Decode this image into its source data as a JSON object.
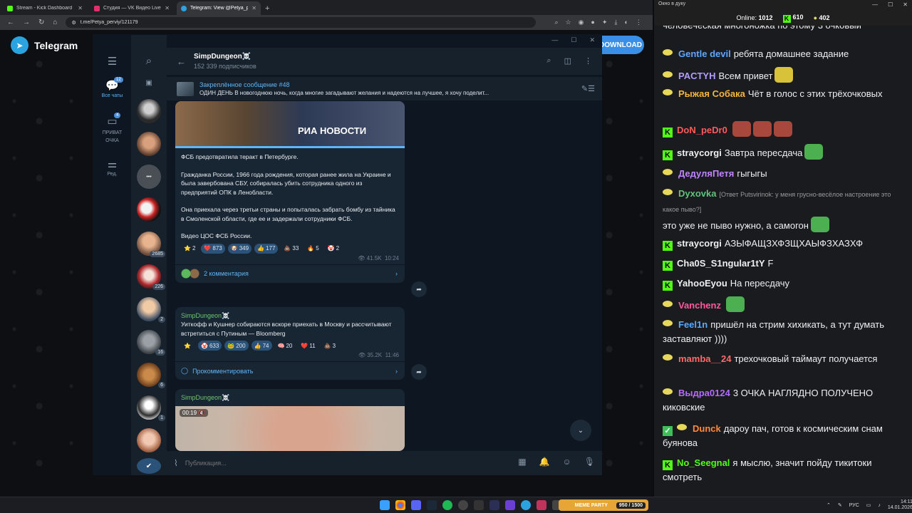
{
  "browser": {
    "tabs": [
      {
        "label": "Stream - Kick Dashboard",
        "color": "#53fc18"
      },
      {
        "label": "Студия — VK Видео Live",
        "color": "#e0306b"
      },
      {
        "label": "Telegram: View @Petya_perviy",
        "color": "#2aa3e0"
      }
    ],
    "new_tab": "+",
    "url": "t.me/Petya_perviy/121179"
  },
  "telegram_web": {
    "logo_text": "Telegram",
    "download_label": "DOWNLOAD"
  },
  "tg": {
    "rail": {
      "all_chats": "Все чаты",
      "all_chats_badge": "12",
      "private": "ПРИВАТ ОЧКА",
      "private_badge": "4",
      "edit": "Ред."
    },
    "avatar_badges": [
      "2685",
      "226",
      "2",
      "16",
      "6",
      "1"
    ],
    "channel": {
      "title": "SimpDungeon☠️",
      "subscribers": "152 339 подписчиков"
    },
    "pinned": {
      "title": "Закреплённое сообщение #48",
      "text": "ОДИН ДЕНЬ  В новогоднюю ночь, когда многие загадывают желания и надеются на лучшее, я хочу поделит..."
    },
    "post1": {
      "image_watermark": "РИА НОВОСТИ",
      "p1": "ФСБ предотвратила теракт в Петербурге.",
      "p2": "Гражданка России, 1966 года рождения, которая ранее жила на Украине и была завербована СБУ, собиралась убить сотрудника одного из предприятий ОПК в Ленобласти.",
      "p3": "Она приехала через третьи страны и попыталась забрать бомбу из тайника в Смоленской области, где ее и задержали сотрудники ФСБ.",
      "p4": "Видео ЦОС ФСБ России.",
      "reactions": [
        {
          "e": "⭐",
          "n": "2",
          "plain": true
        },
        {
          "e": "❤️",
          "n": "873"
        },
        {
          "e": "🐶",
          "n": "349"
        },
        {
          "e": "👍",
          "n": "177"
        },
        {
          "e": "💩",
          "n": "33",
          "plain": true
        },
        {
          "e": "🔥",
          "n": "5",
          "plain": true
        },
        {
          "e": "🤡",
          "n": "2",
          "plain": true
        }
      ],
      "views": "41.5K",
      "time": "10:24",
      "comments": "2 комментария"
    },
    "post2": {
      "sender": "SimpDungeon☠️",
      "text": "Уиткофф и Кушнер собираются вскоре приехать в Москву и рассчитывают встретиться с Путиным — Bloomberg",
      "reactions": [
        {
          "e": "⭐",
          "n": "",
          "plain": true
        },
        {
          "e": "🤡",
          "n": "633"
        },
        {
          "e": "🐸",
          "n": "200"
        },
        {
          "e": "👍",
          "n": "74"
        },
        {
          "e": "🧠",
          "n": "20",
          "plain": true
        },
        {
          "e": "❤️",
          "n": "11",
          "plain": true
        },
        {
          "e": "💩",
          "n": "3",
          "plain": true
        }
      ],
      "views": "35.2K",
      "time": "11:46",
      "comment_cta": "Прокомментировать"
    },
    "post3": {
      "sender": "SimpDungeon☠️",
      "duration": "00:19"
    },
    "composer_placeholder": "Публикация..."
  },
  "kick": {
    "window_title": "Окно в дуку",
    "online_label": "Online:",
    "online": "1012",
    "stat1": "610",
    "stat2": "402",
    "messages": [
      {
        "user": "",
        "text": "человеческая многоножка по этому 3 очковый",
        "color": "#efefef",
        "badge": "none"
      },
      {
        "user": "Gentle devil",
        "text": "ребята домашнее задание",
        "color": "#5fa8ff",
        "badge": "s"
      },
      {
        "user": "PACTYH",
        "text": "Всем привет",
        "color": "#b39cff",
        "badge": "s"
      },
      {
        "user": "Рыжая Собака",
        "text": "Чёт в голос с этих трёхочковых",
        "color": "#f5b63b",
        "badge": "s"
      },
      {
        "user": "DoN_peDr0",
        "text": "",
        "color": "#ff5a5a",
        "badge": "k"
      },
      {
        "user": "straycorgi",
        "text": "Завтра пересдача",
        "color": "#efefef",
        "badge": "k"
      },
      {
        "user": "ДедуляПетя",
        "text": "гыгыгы",
        "color": "#c084ff",
        "badge": "s"
      },
      {
        "user": "Dyxovka",
        "reply": "[Ответ Putsvirinok: у меня грусно-весёлое настроение это какое пыво?]",
        "text": "это уже не пыво нужно, а самогон",
        "color": "#63c27a",
        "badge": "s"
      },
      {
        "user": "straycorgi",
        "text": "АЗЫФАЩЗХФЗЩХАЫФЗХАЗХФ",
        "color": "#efefef",
        "badge": "k"
      },
      {
        "user": "Cha0S_S1ngular1tY",
        "text": "F",
        "color": "#efefef",
        "badge": "k"
      },
      {
        "user": "YahooEyou",
        "text": "На пересдачу",
        "color": "#efefef",
        "badge": "k"
      },
      {
        "user": "Vanchenz",
        "text": "",
        "color": "#ff5a9e",
        "badge": "s"
      },
      {
        "user": "Feel1n",
        "text": "пришёл на стрим хихикать, а тут думать заставляют ))))",
        "color": "#5fa8ff",
        "badge": "s"
      },
      {
        "user": "mamba__24",
        "text": "трехочковый таймаут получается",
        "color": "#ff6a6a",
        "badge": "s"
      },
      {
        "user": "Выдра0124",
        "text": "3 ОЧКА НАГЛЯДНО ПОЛУЧЕНО киковские",
        "color": "#b56bff",
        "badge": "s"
      },
      {
        "user": "Dunck",
        "text": "дароу пач, готов к космическим снам буянова",
        "color": "#ff8a3d",
        "badge": "ds"
      },
      {
        "user": "No_Seegnal",
        "text": "я мыслю, значит пойду тикитоки смотреть",
        "color": "#53fc18",
        "badge": "k"
      }
    ]
  },
  "taskbar": {
    "game_counter": "950 / 1500",
    "game_label": "MEME PARTY",
    "lang": "РУС",
    "time": "14:11",
    "date": "14.01.2026"
  }
}
